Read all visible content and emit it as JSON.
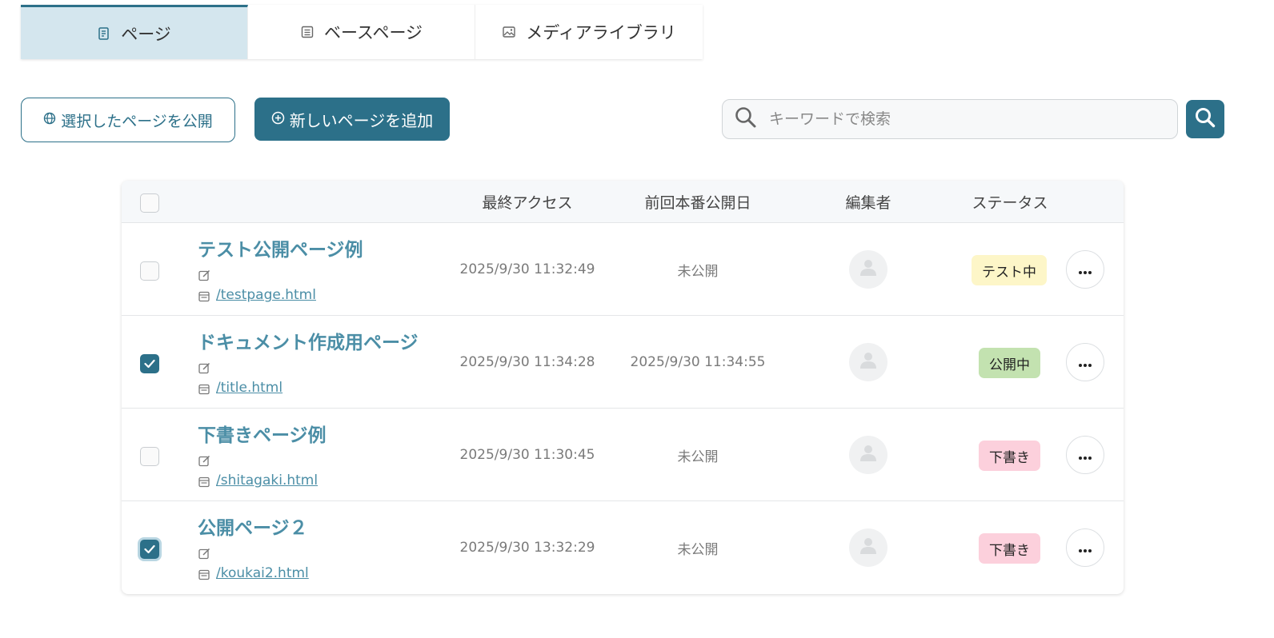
{
  "tabs": [
    {
      "label": "ページ",
      "icon": "page-icon",
      "active": true
    },
    {
      "label": "ベースページ",
      "icon": "base-page-icon",
      "active": false
    },
    {
      "label": "メディアライブラリ",
      "icon": "image-icon",
      "active": false
    }
  ],
  "toolbar": {
    "publish_selected_label": "選択したページを公開",
    "add_page_label": "新しいページを追加",
    "search_placeholder": "キーワードで検索",
    "search_value": ""
  },
  "table": {
    "headers": {
      "last_access": "最終アクセス",
      "last_published": "前回本番公開日",
      "editor": "編集者",
      "status": "ステータス"
    },
    "rows": [
      {
        "checked": false,
        "title": "テスト公開ページ例",
        "path": "/testpage.html",
        "last_access": "2025/9/30 11:32:49",
        "last_published": "未公開",
        "status": "テスト中",
        "status_color": "#fdf6c8"
      },
      {
        "checked": true,
        "title": "ドキュメント作成用ページ",
        "path": "/title.html",
        "last_access": "2025/9/30 11:34:28",
        "last_published": "2025/9/30 11:34:55",
        "status": "公開中",
        "status_color": "#c3e2b0"
      },
      {
        "checked": false,
        "title": "下書きページ例",
        "path": "/shitagaki.html",
        "last_access": "2025/9/30 11:30:45",
        "last_published": "未公開",
        "status": "下書き",
        "status_color": "#fcd0dc"
      },
      {
        "checked": true,
        "title": "公開ページ２",
        "path": "/koukai2.html",
        "last_access": "2025/9/30 13:32:29",
        "last_published": "未公開",
        "status": "下書き",
        "status_color": "#fcd0dc"
      }
    ]
  },
  "colors": {
    "accent": "#2c7089",
    "link": "#4b8ea6",
    "tab_active_bg": "#d4e6ee"
  }
}
